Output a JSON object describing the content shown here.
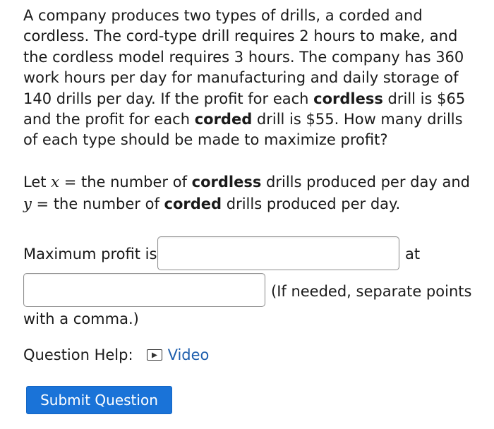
{
  "problem": {
    "p1": "A company produces two types of drills, a corded and cordless. The cord-type drill requires 2 hours to make, and the cordless model requires 3 hours. The company has 360 work hours per day for manufacturing and daily storage of 140 drills per day. If the profit for each ",
    "bold_cordless": "cordless",
    "p2": " drill is $65 and the profit for each ",
    "bold_corded": "corded",
    "p3": " drill is $55. How many drills of each type should be made to maximize profit?"
  },
  "let": {
    "t1": "Let ",
    "var_x": "x",
    "t2": " = the number of ",
    "bold_cordless": "cordless",
    "t3": " drills produced per day and ",
    "var_y": "y",
    "t4": " = the number of ",
    "bold_corded": "corded",
    "t5": " drills produced per day."
  },
  "answer": {
    "max_label": "Maximum profit is",
    "at_label": "at",
    "max_value": "",
    "point_value": "",
    "hint_line1": "(If needed, separate points",
    "hint_line2": "with a comma.)"
  },
  "help": {
    "label": "Question Help:",
    "video_label": "Video",
    "video_icon": "play-video-icon"
  },
  "submit": {
    "label": "Submit Question"
  },
  "colors": {
    "link": "#1f5fad",
    "button": "#1a73d8",
    "text": "#1a1a1a"
  }
}
